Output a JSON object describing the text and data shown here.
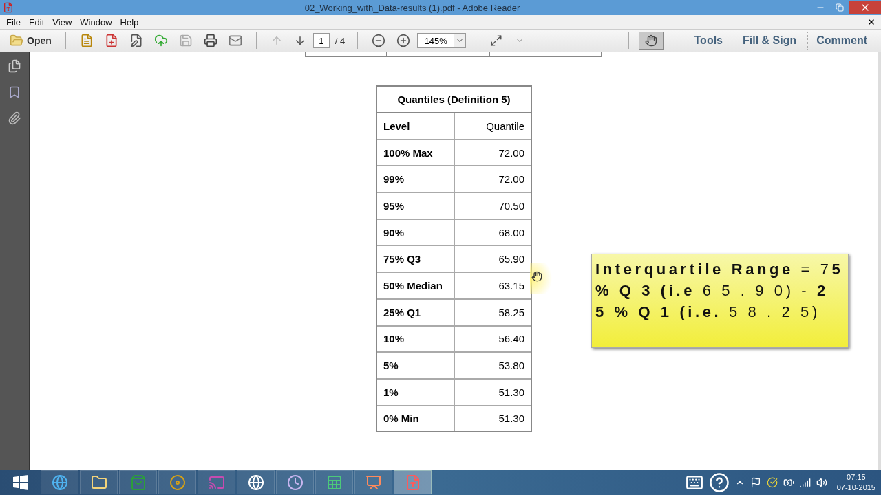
{
  "window": {
    "title": "02_Working_with_Data-results (1).pdf - Adobe Reader"
  },
  "menu": [
    "File",
    "Edit",
    "View",
    "Window",
    "Help"
  ],
  "toolbar": {
    "open": "Open",
    "page": "1",
    "page_total": "/ 4",
    "zoom": "145%",
    "hand_tool_selected": true,
    "panels": [
      "Tools",
      "Fill & Sign",
      "Comment"
    ]
  },
  "table": {
    "title": "Quantiles (Definition 5)",
    "columns": [
      "Level",
      "Quantile"
    ],
    "rows": [
      [
        "100% Max",
        "72.00"
      ],
      [
        "99%",
        "72.00"
      ],
      [
        "95%",
        "70.50"
      ],
      [
        "90%",
        "68.00"
      ],
      [
        "75% Q3",
        "65.90"
      ],
      [
        "50% Median",
        "63.15"
      ],
      [
        "25% Q1",
        "58.25"
      ],
      [
        "10%",
        "56.40"
      ],
      [
        "5%",
        "53.80"
      ],
      [
        "1%",
        "51.30"
      ],
      [
        "0% Min",
        "51.30"
      ]
    ]
  },
  "note": "**Interquartile Range** = 7**5 % Q 3 (i.e** 6 5 . 9 0) - **2 5 % Q 1 (i.e.** 5 8 . 2 5)",
  "clock": {
    "time": "07:15",
    "date": "07-10-2015"
  }
}
